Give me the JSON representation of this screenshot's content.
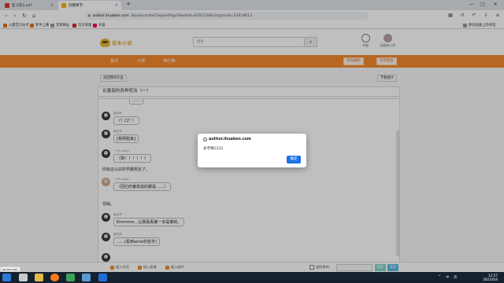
{
  "browser": {
    "tabs": [
      {
        "title": "复习卷2.pdf",
        "close": "×"
      },
      {
        "title": "创建章节",
        "close": "×"
      }
    ],
    "new_tab": "+",
    "window_controls": [
      "—",
      "▢",
      "✕"
    ],
    "nav": {
      "back": "‹",
      "forward": "›",
      "reload": "↻",
      "home": "⌂"
    },
    "url_host": "author.ihuaben.com",
    "url_path": "/book/createChapterPage?bookId=8291128&chapterId=53018613",
    "bookmarks": [
      "火狐官方站点",
      "新手上路",
      "常用网址",
      "京东商城",
      "天猫"
    ],
    "bookmark_right": "移动设备上的书签",
    "colors": {
      "tab_bar": "#dfe3e8",
      "accent": "#f48a2e",
      "dialog_ok": "#1a73e8"
    }
  },
  "site": {
    "logo_text": "话本小说",
    "search_placeholder": "搜索",
    "search_icon": "search-icon",
    "header_icons": [
      {
        "label": "书架",
        "icon": "bookshelf-icon"
      },
      {
        "label": "无敌哈士奇",
        "icon": "avatar-icon"
      }
    ],
    "nav": [
      "首页",
      "分类",
      "排行榜"
    ],
    "nav_buttons": [
      "写作福利",
      "写作后台"
    ],
    "back_button": "返回我的作品",
    "stats_button": "字数统计",
    "chapter_title": "论番茄的各种死法（一）"
  },
  "editor": {
    "messages": [
      {
        "name": "番茄哥",
        "text": "（？口？）",
        "avatar": "dark"
      },
      {
        "name": "番茄哥",
        "text": "[我哭腔来]",
        "avatar": "dark"
      },
      {
        "name": "一只huaben",
        "text": "（哭！！！！！）",
        "avatar": "dark"
      },
      {
        "name": "一只huaben",
        "text": "（回忆时番茄说的都是……）",
        "avatar": "tan"
      },
      {
        "name": "番茄哥",
        "text": "Emmmm...让我看看第一本是谁的。",
        "avatar": "dark"
      },
      {
        "name": "番茄哥",
        "text": "……(看到error的名字)",
        "avatar": "dark"
      }
    ],
    "plain_lines": [
      "你有这么好的学霸男友了。",
      "领域。"
    ],
    "top_partial": "……"
  },
  "composer": {
    "buttons": [
      "插入对话",
      "插入表情",
      "插入图片"
    ],
    "timer_label": "定时发布：",
    "save": "保存",
    "publish": "发布"
  },
  "dialog": {
    "title": "author.ihuaben.com",
    "message": "总字数2222",
    "ok": "确定"
  },
  "status_text": "javascript;",
  "taskbar": {
    "clock_time": "12:57",
    "clock_date": "2022/6/4",
    "tray": [
      "^",
      "中",
      "英"
    ]
  }
}
